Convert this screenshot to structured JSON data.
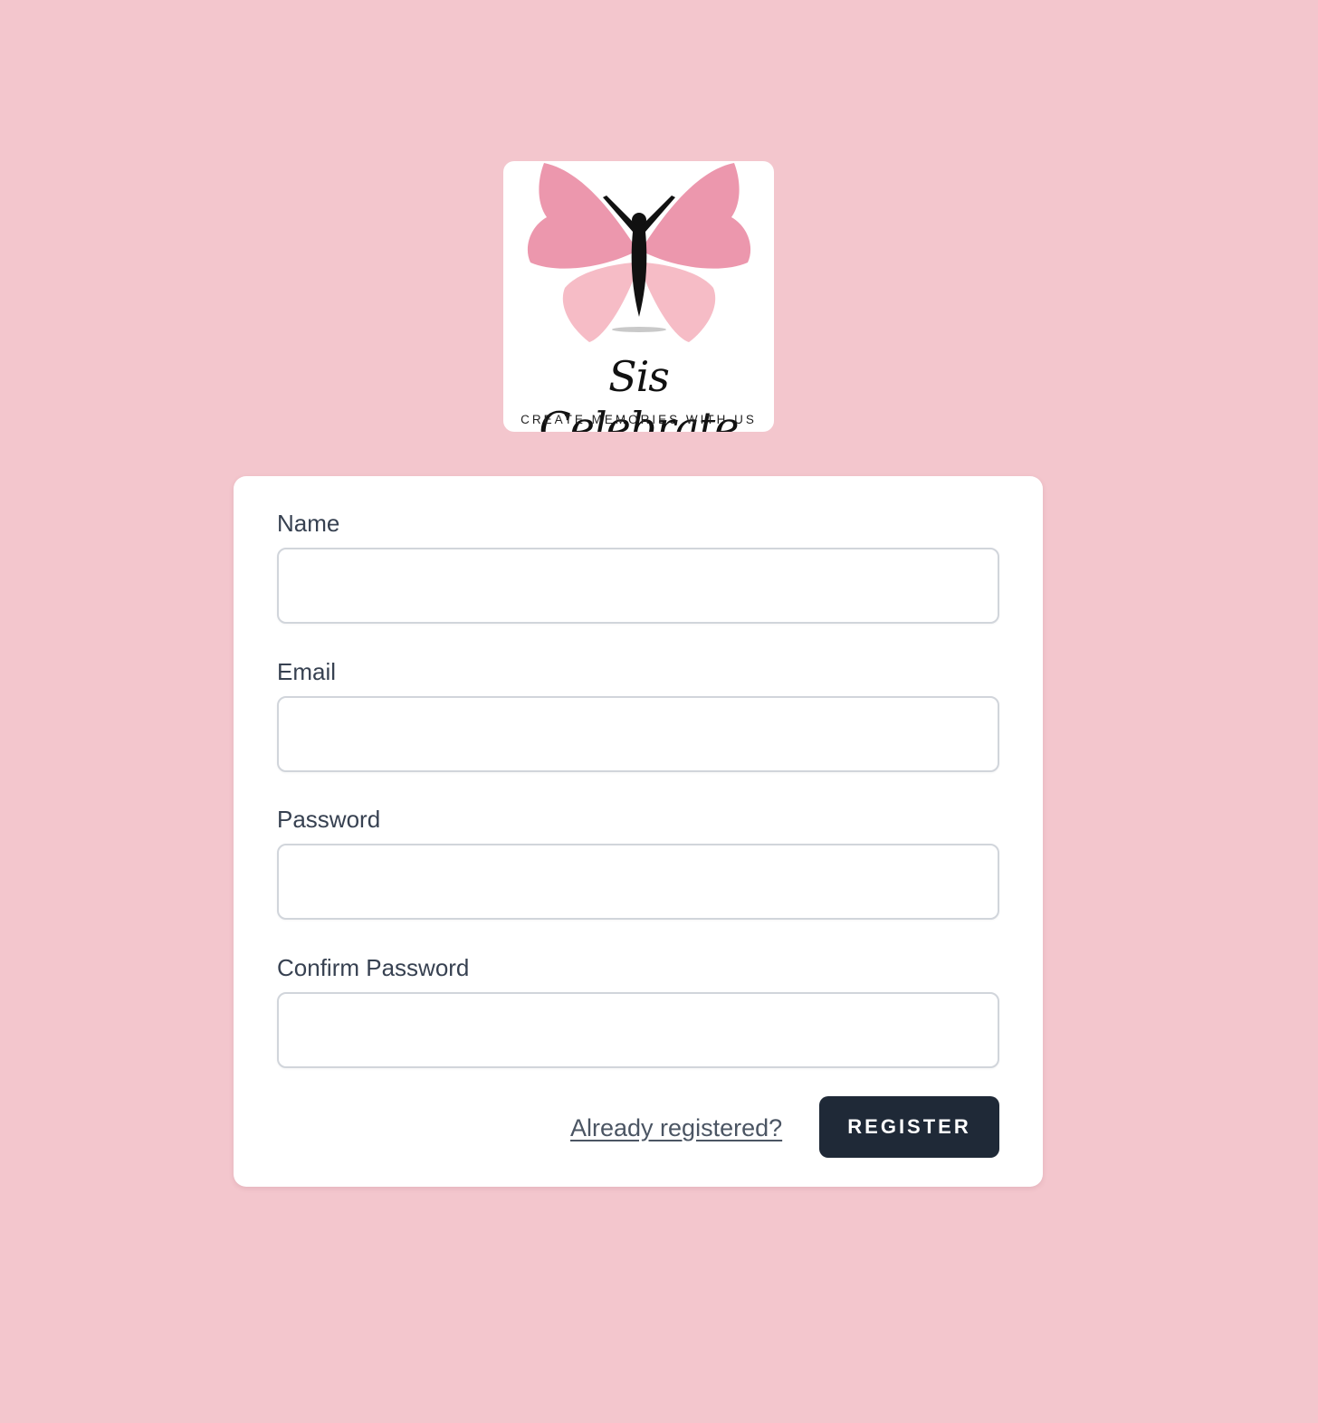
{
  "brand": {
    "logo_script_text": "Sis Celebrate",
    "logo_tagline": "CREATE MEMORIES WITH US",
    "colors": {
      "background": "#f3c6cd",
      "wing_upper": "#ec97ad",
      "wing_lower": "#f6bcc6",
      "figure": "#111111"
    }
  },
  "form": {
    "name_label": "Name",
    "email_label": "Email",
    "password_label": "Password",
    "confirm_password_label": "Confirm Password",
    "name_value": "",
    "email_value": "",
    "password_value": "",
    "confirm_password_value": "",
    "already_registered_link": "Already registered?",
    "register_button": "REGISTER",
    "button_color": "#1f2937"
  }
}
